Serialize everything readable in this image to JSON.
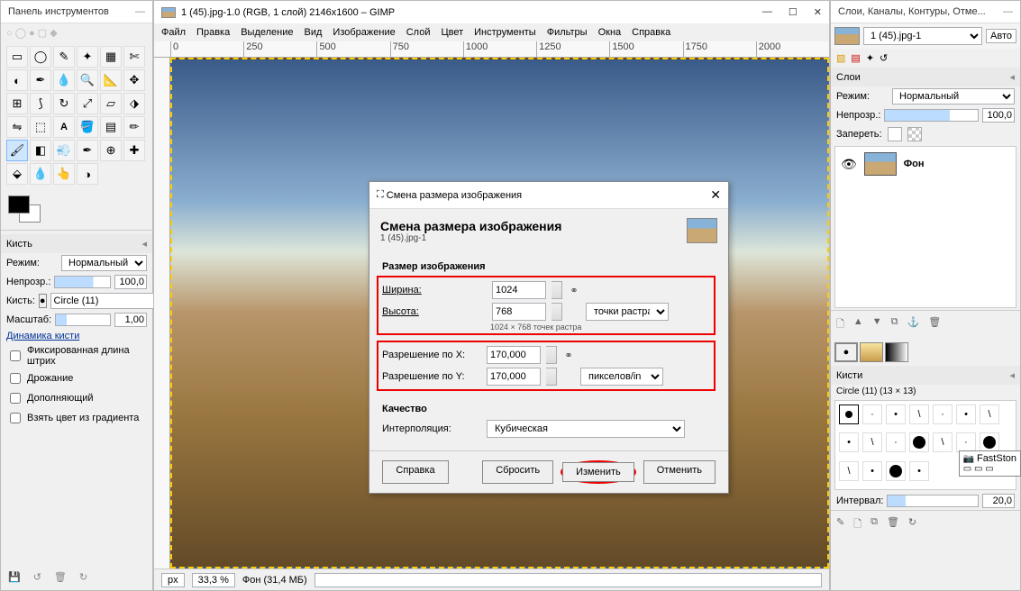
{
  "toolbox": {
    "title": "Панель инструментов",
    "brush_section": "Кисть",
    "mode_label": "Режим:",
    "mode_value": "Нормальный",
    "opacity_label": "Непрозр.:",
    "opacity_value": "100,0",
    "brush_label": "Кисть:",
    "brush_value": "Circle (11)",
    "scale_label": "Масштаб:",
    "scale_value": "1,00",
    "dynamics_link": "Динамика кисти",
    "opts": [
      "Фиксированная длина штрих",
      "Дрожание",
      "Дополняющий",
      "Взять цвет из градиента"
    ]
  },
  "center": {
    "title": "1 (45).jpg-1.0 (RGB, 1 слой) 2146x1600 – GIMP",
    "menu": [
      "Файл",
      "Правка",
      "Выделение",
      "Вид",
      "Изображение",
      "Слой",
      "Цвет",
      "Инструменты",
      "Фильтры",
      "Окна",
      "Справка"
    ],
    "ruler": [
      "0",
      "250",
      "500",
      "750",
      "1000",
      "1250",
      "1500",
      "1750",
      "2000"
    ],
    "status_unit": "px",
    "status_zoom": "33,3 %",
    "status_info": "Фон (31,4 МБ)"
  },
  "dialog": {
    "titlebar": "Смена размера изображения",
    "heading": "Смена размера изображения",
    "sub": "1 (45).jpg-1",
    "size_section": "Размер изображения",
    "width_label": "Ширина:",
    "width_value": "1024",
    "height_label": "Высота:",
    "height_value": "768",
    "unit1": "точки растра",
    "hint": "1024 × 768 точек растра",
    "resx_label": "Разрешение по X:",
    "resx_value": "170,000",
    "resy_label": "Разрешение по Y:",
    "resy_value": "170,000",
    "unit2": "пикселов/in",
    "quality_section": "Качество",
    "interp_label": "Интерполяция:",
    "interp_value": "Кубическая",
    "buttons": {
      "help": "Справка",
      "reset": "Сбросить",
      "ok": "Изменить",
      "cancel": "Отменить"
    }
  },
  "right": {
    "title": "Слои, Каналы, Контуры, Отме...",
    "layer_select": "1 (45).jpg-1",
    "auto": "Авто",
    "layers_section": "Слои",
    "mode_label": "Режим:",
    "mode_value": "Нормальный",
    "opacity_label": "Непрозр.:",
    "opacity_value": "100,0",
    "lock_label": "Запереть:",
    "layer_name": "Фон",
    "brushes_section": "Кисти",
    "brush_current": "Circle (11) (13 × 13)",
    "interval_label": "Интервал:",
    "interval_value": "20,0",
    "faststone": "FastSton"
  }
}
